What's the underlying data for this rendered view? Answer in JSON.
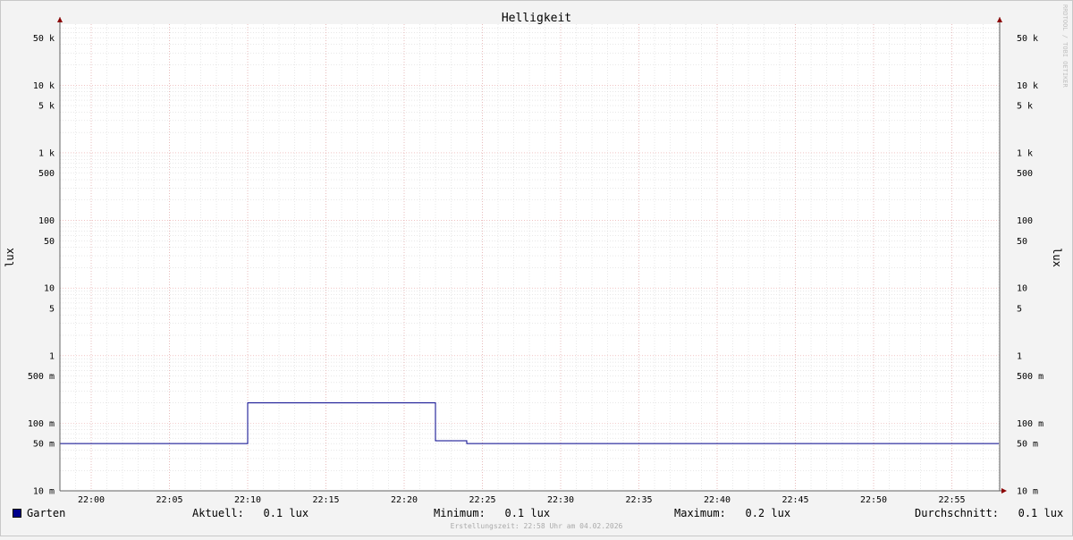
{
  "chart_data": {
    "type": "line",
    "title": "Helligkeit",
    "ylabel_left": "lux",
    "ylabel_right": "lux",
    "y_scale": "log",
    "ylim": [
      0.01,
      80000
    ],
    "xlim": [
      "21:58",
      "23:58"
    ],
    "x_ticks": [
      "22:00",
      "22:05",
      "22:10",
      "22:15",
      "22:20",
      "22:25",
      "22:30",
      "22:35",
      "22:40",
      "22:45",
      "22:50",
      "22:55"
    ],
    "y_ticks": [
      {
        "value": 50000,
        "label": "50 k"
      },
      {
        "value": 10000,
        "label": "10 k"
      },
      {
        "value": 5000,
        "label": "5 k"
      },
      {
        "value": 1000,
        "label": "1 k"
      },
      {
        "value": 500,
        "label": "500"
      },
      {
        "value": 100,
        "label": "100"
      },
      {
        "value": 50,
        "label": "50"
      },
      {
        "value": 10,
        "label": "10"
      },
      {
        "value": 5,
        "label": "5"
      },
      {
        "value": 1,
        "label": "1"
      },
      {
        "value": 0.5,
        "label": "500 m"
      },
      {
        "value": 0.1,
        "label": "100 m"
      },
      {
        "value": 0.05,
        "label": "50 m"
      },
      {
        "value": 0.01,
        "label": "10 m"
      }
    ],
    "series": [
      {
        "name": "Garten",
        "color": "#00008b",
        "points": [
          {
            "x": "21:58",
            "y": 0.05
          },
          {
            "x": "22:10",
            "y": 0.05
          },
          {
            "x": "22:10",
            "y": 0.2
          },
          {
            "x": "22:22",
            "y": 0.2
          },
          {
            "x": "22:22",
            "y": 0.055
          },
          {
            "x": "22:24",
            "y": 0.055
          },
          {
            "x": "22:24",
            "y": 0.05
          },
          {
            "x": "22:58",
            "y": 0.05
          }
        ]
      }
    ],
    "grid": true,
    "watermark": "RRDTOOL / TOBI OETIKER"
  },
  "legend": {
    "series_name": "Garten",
    "current": "Aktuell:   0.1 lux",
    "minimum": "Minimum:   0.1 lux",
    "maximum": "Maximum:   0.2 lux",
    "average": "Durchschnitt:   0.1 lux"
  },
  "footer": "Erstellungszeit: 22:58 Uhr am 04.02.2026",
  "colors": {
    "background": "#f3f3f3",
    "plot_background": "#ffffff",
    "grid_minor": "#d0d0d0",
    "grid_major": "#e8a0a0",
    "series": "#00008b",
    "axis": "#8b0000"
  }
}
